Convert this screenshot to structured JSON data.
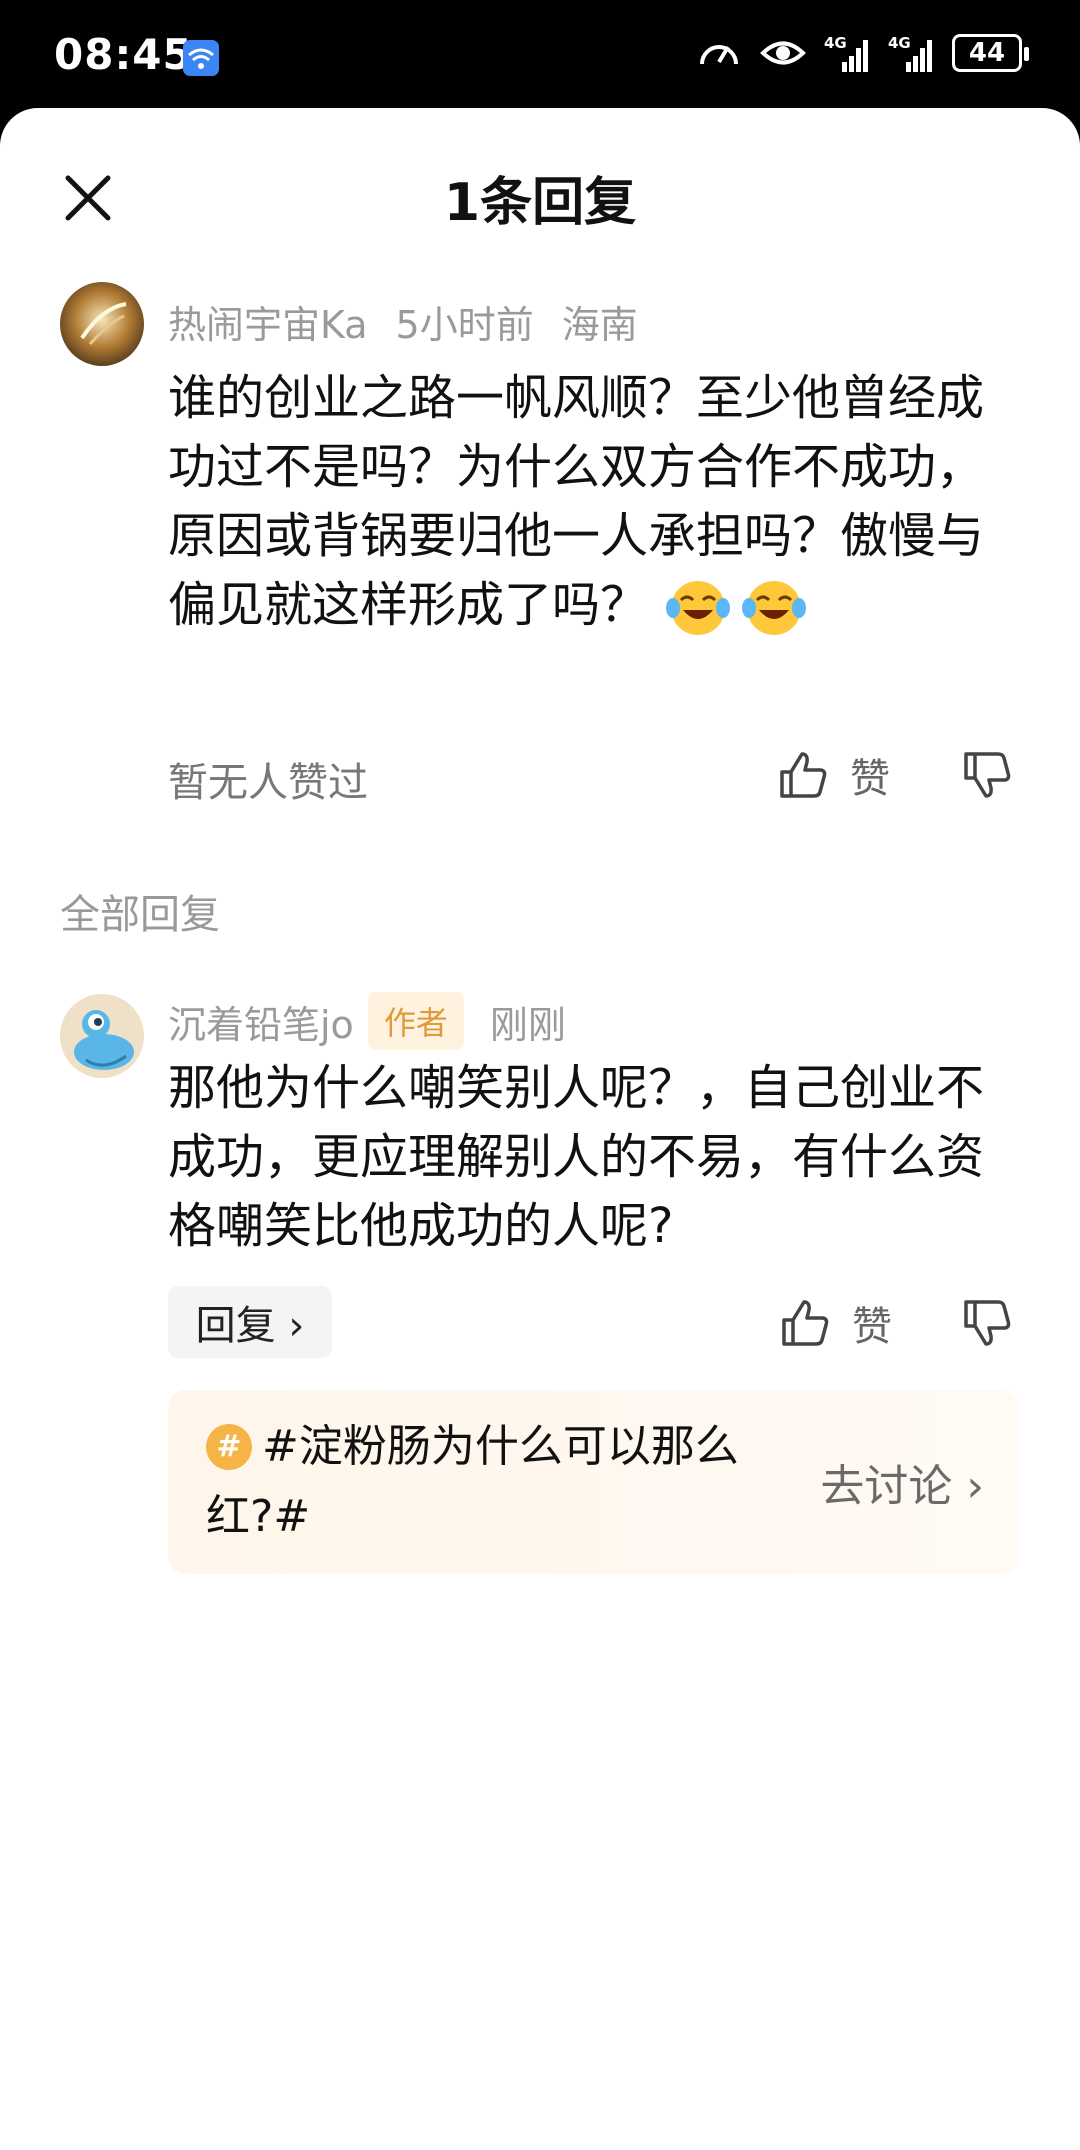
{
  "status_bar": {
    "time": "08:45",
    "battery": "44",
    "icons": [
      "wifi-badge-icon",
      "speedometer-icon",
      "eye-icon",
      "signal-4g-icon",
      "signal-4g-icon",
      "battery-icon"
    ]
  },
  "header": {
    "title": "1条回复",
    "close_icon": "close-icon"
  },
  "main_comment": {
    "username": "热闹宇宙Ka",
    "time": "5小时前",
    "location": "海南",
    "text": "谁的创业之路一帆风顺？至少他曾经成功过不是吗？为什么双方合作不成功，原因或背锅要归他一人承担吗？傲慢与偏见就这样形成了吗？",
    "emojis": [
      "laughing-crying-emoji",
      "laughing-crying-emoji"
    ],
    "likes_text": "暂无人赞过",
    "like_label": "赞"
  },
  "section_title": "全部回复",
  "reply": {
    "username": "沉着铅笔jo",
    "tag": "作者",
    "time": "刚刚",
    "text": "那他为什么嘲笑别人呢？，自己创业不成功，更应理解别人的不易，有什么资格嘲笑比他成功的人呢?",
    "reply_label": "回复 ›",
    "like_label": "赞"
  },
  "topic_card": {
    "hash_symbol": "#",
    "text": "#淀粉肠为什么可以那么红?#",
    "action": "去讨论 ›"
  },
  "colors": {
    "accent_orange": "#f5b445",
    "author_tag_text": "#e09a3a",
    "meta_gray": "#9a9a9a"
  }
}
